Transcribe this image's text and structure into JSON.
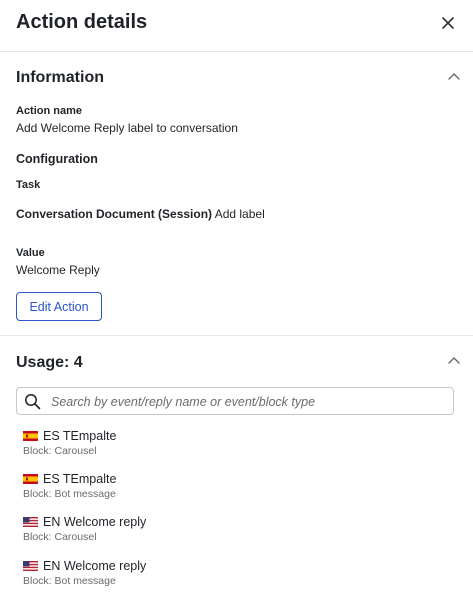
{
  "header": {
    "title": "Action details"
  },
  "information": {
    "title": "Information",
    "action_name_label": "Action name",
    "action_name_value": "Add Welcome Reply label to conversation",
    "configuration_title": "Configuration",
    "task_label": "Task",
    "task_object": "Conversation Document (Session)",
    "task_operation": "Add label",
    "value_label": "Value",
    "value_value": "Welcome Reply",
    "edit_button_label": "Edit Action"
  },
  "usage": {
    "title": "Usage: 4",
    "search_placeholder": "Search by event/reply name or event/block type",
    "items": [
      {
        "flag": "es-flag-icon",
        "name": "ES TEmpalte",
        "type": "Block: Carousel"
      },
      {
        "flag": "es-flag-icon",
        "name": "ES TEmpalte",
        "type": "Block: Bot message"
      },
      {
        "flag": "us-flag-icon",
        "name": "EN Welcome reply",
        "type": "Block: Carousel"
      },
      {
        "flag": "us-flag-icon",
        "name": "EN Welcome reply",
        "type": "Block: Bot message"
      }
    ]
  },
  "icons": {
    "close": "close-icon",
    "collapse": "chevron-up-icon",
    "search": "search-icon"
  },
  "colors": {
    "accent": "#2c55c7",
    "divider": "#e6e6e6",
    "muted_text": "#6b6b6b"
  }
}
